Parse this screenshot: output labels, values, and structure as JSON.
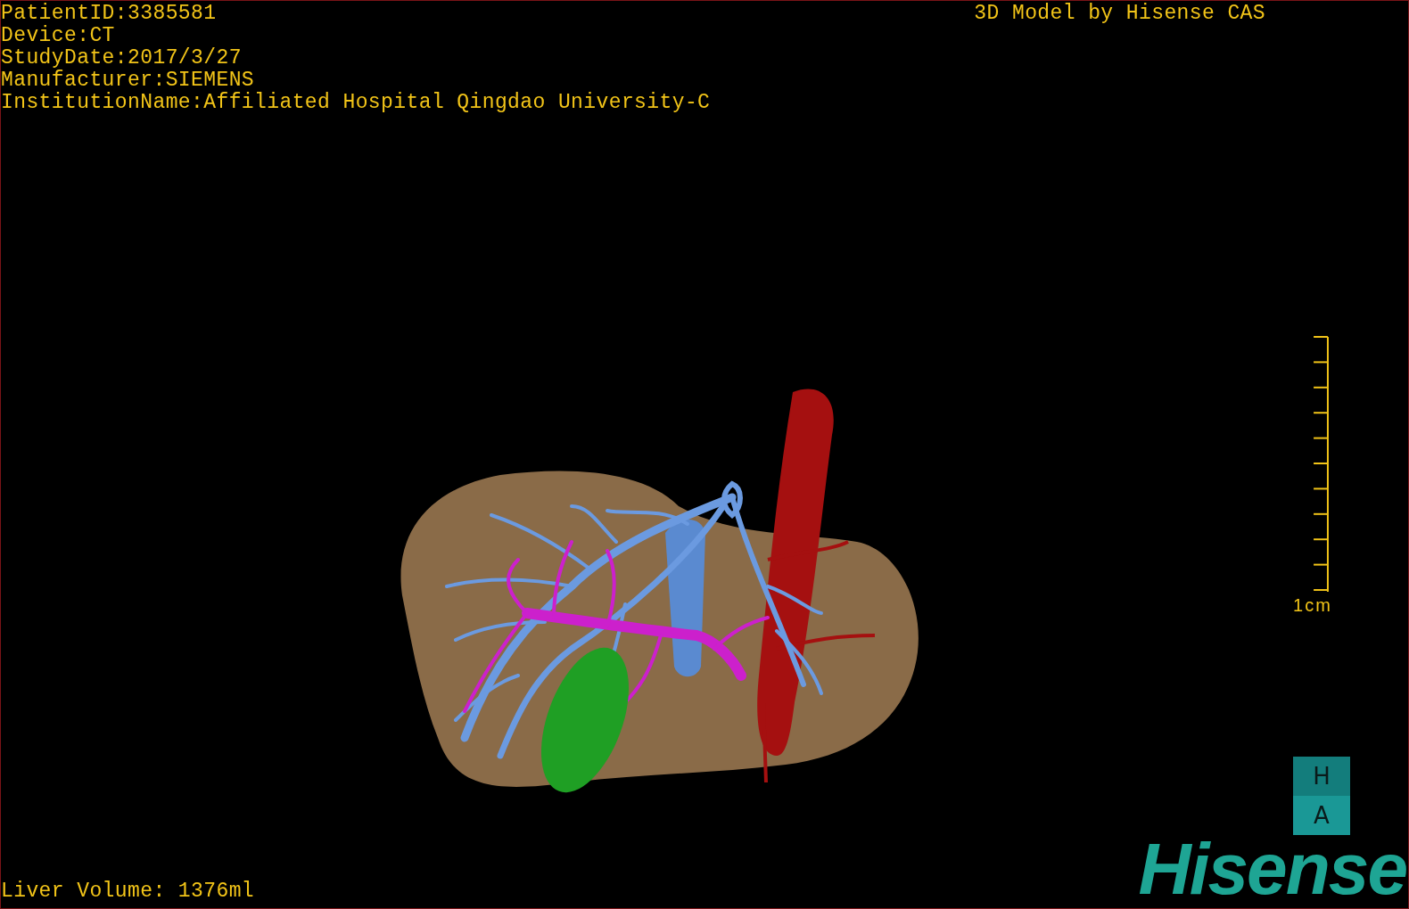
{
  "patient_info": [
    "PatientID:3385581",
    "Device:CT",
    "StudyDate:2017/3/27",
    "Manufacturer:SIEMENS",
    "InstitutionName:Affiliated Hospital Qingdao University-C"
  ],
  "model_credit": "3D Model by Hisense CAS",
  "scale_bar": {
    "label": "1cm"
  },
  "orientation_cube": {
    "top_face": "H",
    "front_face": "A"
  },
  "logo": "Hisense",
  "liver_volume": "Liver Volume: 1376ml"
}
